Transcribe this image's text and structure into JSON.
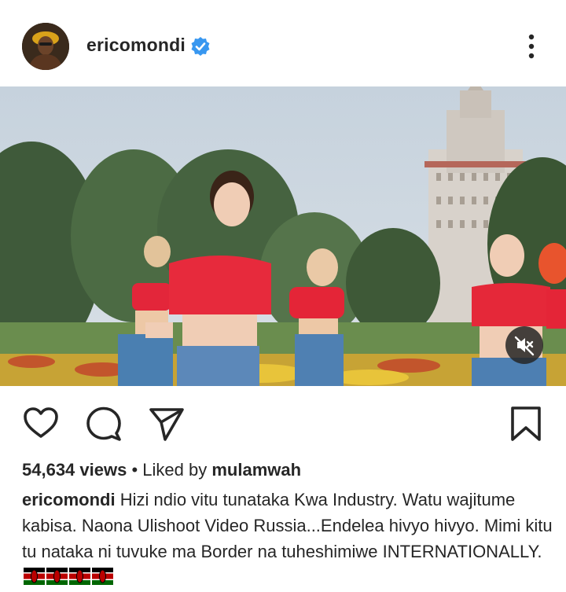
{
  "post": {
    "username": "ericomondi",
    "verified": true,
    "views": "54,634 views",
    "separator": "•",
    "liked_by_prefix": "Liked by",
    "liked_by_user": "mulamwah",
    "caption_text": "Hizi ndio vitu tunataka Kwa Industry. Watu wajitume kabisa. Naona Ulishoot Video Russia...Endelea hivyo hivyo. Mimi kitu tu nataka ni tuvuke ma Border na tuheshimiwe INTERNATIONALLY.",
    "caption_flags": "🇰🇪🇰🇪🇰🇪🇰🇪",
    "flag_count": 4
  },
  "icons": {
    "avatar": "profile-photo",
    "verified": "verified-badge-icon",
    "more": "more-options-icon",
    "mute": "muted-speaker-icon",
    "like": "heart-outline-icon",
    "comment": "comment-bubble-icon",
    "share": "paper-plane-icon",
    "save": "bookmark-outline-icon"
  },
  "colors": {
    "text": "#262626",
    "verified_blue": "#3897f0",
    "background": "#ffffff",
    "mute_button_bg": "#262626"
  }
}
